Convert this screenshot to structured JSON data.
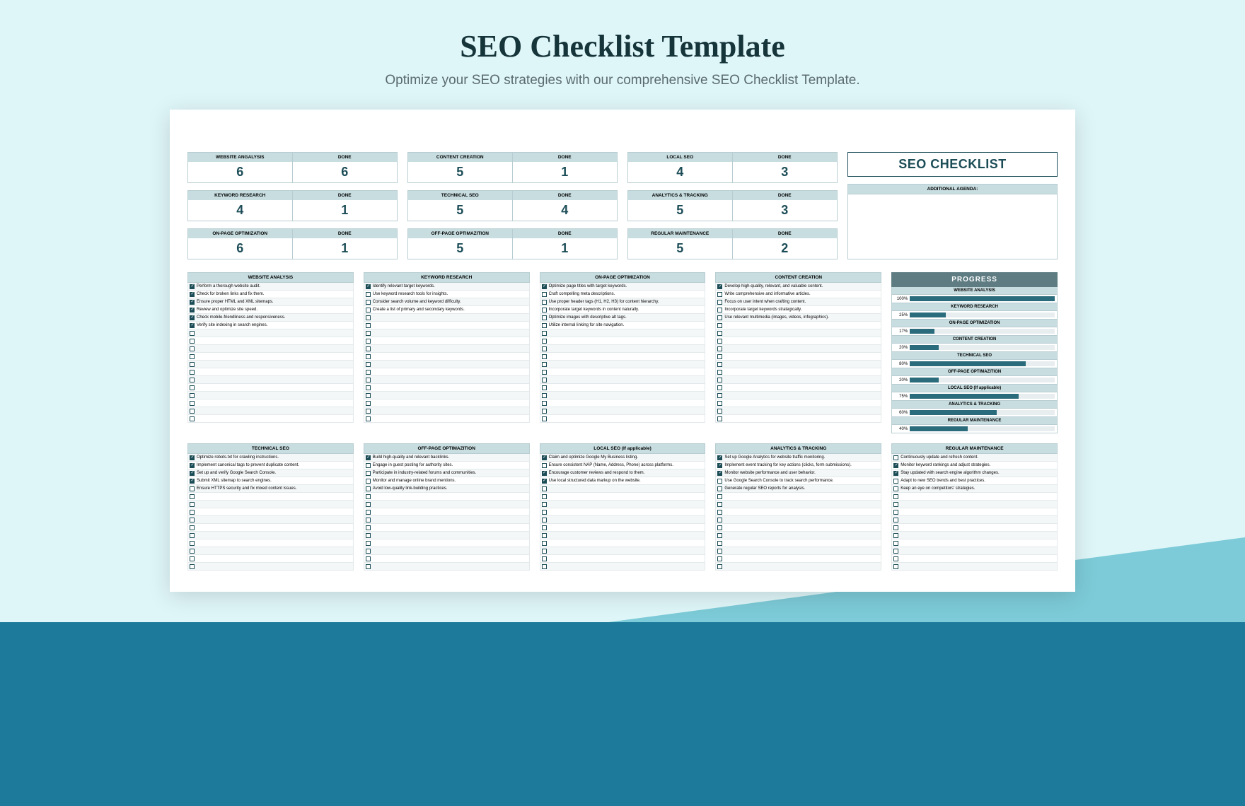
{
  "header": {
    "title": "SEO Checklist Template",
    "subtitle": "Optimize your SEO strategies with our comprehensive SEO Checklist Template."
  },
  "seo_title": "SEO CHECKLIST",
  "agenda_label": "ADDITIONAL AGENDA:",
  "done_label": "DONE",
  "stats": [
    {
      "label": "WEBSITE ANGALYSIS",
      "total": "6",
      "done": "6"
    },
    {
      "label": "CONTENT CREATION",
      "total": "5",
      "done": "1"
    },
    {
      "label": "LOCAL SEO",
      "total": "4",
      "done": "3"
    },
    {
      "label": "KEYWORD RESEARCH",
      "total": "4",
      "done": "1"
    },
    {
      "label": "TECHNICAL SEO",
      "total": "5",
      "done": "4"
    },
    {
      "label": "ANALYTICS & TRACKING",
      "total": "5",
      "done": "3"
    },
    {
      "label": "ON-PAGE OPTIMIZATION",
      "total": "6",
      "done": "1"
    },
    {
      "label": "OFF-PAGE OPTIMAZITION",
      "total": "5",
      "done": "1"
    },
    {
      "label": "REGULAR MAINTENANCE",
      "total": "5",
      "done": "2"
    }
  ],
  "lists_top": [
    {
      "title": "WEBSITE ANALYSIS",
      "rows": 18,
      "items": [
        {
          "c": true,
          "t": "Perform a thorough website audit."
        },
        {
          "c": true,
          "t": "Check for broken links and fix them."
        },
        {
          "c": true,
          "t": "Ensure proper HTML and XML sitemaps."
        },
        {
          "c": true,
          "t": "Review and optimize site speed."
        },
        {
          "c": true,
          "t": "Check mobile-friendliness and responsiveness."
        },
        {
          "c": true,
          "t": "Verify site indexing in search engines."
        }
      ]
    },
    {
      "title": "KEYWORD RESEARCH",
      "rows": 18,
      "items": [
        {
          "c": true,
          "t": "Identify relevant target keywords."
        },
        {
          "c": false,
          "t": "Use keyword research tools for insights."
        },
        {
          "c": false,
          "t": "Consider search volume and keyword difficulty."
        },
        {
          "c": false,
          "t": "Create a list of primary and secondary keywords."
        }
      ]
    },
    {
      "title": "ON-PAGE OPTIMIZATION",
      "rows": 18,
      "items": [
        {
          "c": true,
          "t": "Optimize page titles with target keywords."
        },
        {
          "c": false,
          "t": "Craft compelling meta descriptions."
        },
        {
          "c": false,
          "t": "Use proper header tags (H1, H2, H3) for content hierarchy."
        },
        {
          "c": false,
          "t": "Incorporate target keywords in content naturally."
        },
        {
          "c": false,
          "t": "Optimize images with descriptive alt tags."
        },
        {
          "c": false,
          "t": "Utilize internal linking for site navigation."
        }
      ]
    },
    {
      "title": "CONTENT CREATION",
      "rows": 18,
      "items": [
        {
          "c": true,
          "t": "Develop high-quality, relevant, and valuable content."
        },
        {
          "c": false,
          "t": "Write comprehensive and informative articles."
        },
        {
          "c": false,
          "t": "Focus on user intent when crafting content."
        },
        {
          "c": false,
          "t": "Incorporate target keywords strategically."
        },
        {
          "c": false,
          "t": "Use relevant multimedia (images, videos, infographics)."
        }
      ]
    }
  ],
  "progress_title": "PROGRESS",
  "progress": [
    {
      "label": "WEBSITE ANALYSIS",
      "pct": 100
    },
    {
      "label": "KEYWORD RESEARCH",
      "pct": 25
    },
    {
      "label": "ON-PAGE OPTIMIZATION",
      "pct": 17
    },
    {
      "label": "CONTENT CREATION",
      "pct": 20
    },
    {
      "label": "TECHNICAL SEO",
      "pct": 80
    },
    {
      "label": "OFF-PAGE OPTIMAZITION",
      "pct": 20
    },
    {
      "label": "LOCAL SEO (If applicable)",
      "pct": 75
    },
    {
      "label": "ANALYTICS & TRACKING",
      "pct": 60
    },
    {
      "label": "REGULAR MAINTENANCE",
      "pct": 40
    }
  ],
  "lists_bottom": [
    {
      "title": "TECHNICAL SEO",
      "rows": 15,
      "items": [
        {
          "c": true,
          "t": "Optimize robots.txt for crawling instructions."
        },
        {
          "c": true,
          "t": "Implement canonical tags to prevent duplicate content."
        },
        {
          "c": true,
          "t": "Set up and verify Google Search Console."
        },
        {
          "c": true,
          "t": "Submit XML sitemap to search engines."
        },
        {
          "c": false,
          "t": "Ensure HTTPS security and fix mixed content issues."
        }
      ]
    },
    {
      "title": "OFF-PAGE OPTIMAZITION",
      "rows": 15,
      "items": [
        {
          "c": true,
          "t": "Build high-quality and relevant backlinks."
        },
        {
          "c": false,
          "t": "Engage in guest posting for authority sites."
        },
        {
          "c": false,
          "t": "Participate in industry-related forums and communities."
        },
        {
          "c": false,
          "t": "Monitor and manage online brand mentions."
        },
        {
          "c": false,
          "t": "Avoid low-quality link-building practices."
        }
      ]
    },
    {
      "title": "LOCAL SEO (If applicable)",
      "rows": 15,
      "items": [
        {
          "c": true,
          "t": "Claim and optimize Google My Business listing."
        },
        {
          "c": false,
          "t": "Ensure consistent NAP (Name, Address, Phone) across platforms."
        },
        {
          "c": true,
          "t": "Encourage customer reviews and respond to them."
        },
        {
          "c": true,
          "t": "Use local structured data markup on the website."
        }
      ]
    },
    {
      "title": "ANALYTICS & TRACKING",
      "rows": 15,
      "items": [
        {
          "c": true,
          "t": "Set up Google Analytics for website traffic monitoring."
        },
        {
          "c": true,
          "t": "Implement event tracking for key actions (clicks, form submissions)."
        },
        {
          "c": true,
          "t": "Monitor website performance and user behavior."
        },
        {
          "c": false,
          "t": "Use Google Search Console to track search performance."
        },
        {
          "c": false,
          "t": "Generate regular SEO reports for analysis."
        }
      ]
    },
    {
      "title": "REGULAR MAINTENANCE",
      "rows": 15,
      "items": [
        {
          "c": false,
          "t": "Continuously update and refresh content."
        },
        {
          "c": true,
          "t": "Monitor keyword rankings and adjust strategies."
        },
        {
          "c": true,
          "t": "Stay updated with search engine algorithm changes."
        },
        {
          "c": false,
          "t": "Adapt to new SEO trends and best practices."
        },
        {
          "c": false,
          "t": "Keep an eye on competitors' strategies."
        }
      ]
    }
  ]
}
